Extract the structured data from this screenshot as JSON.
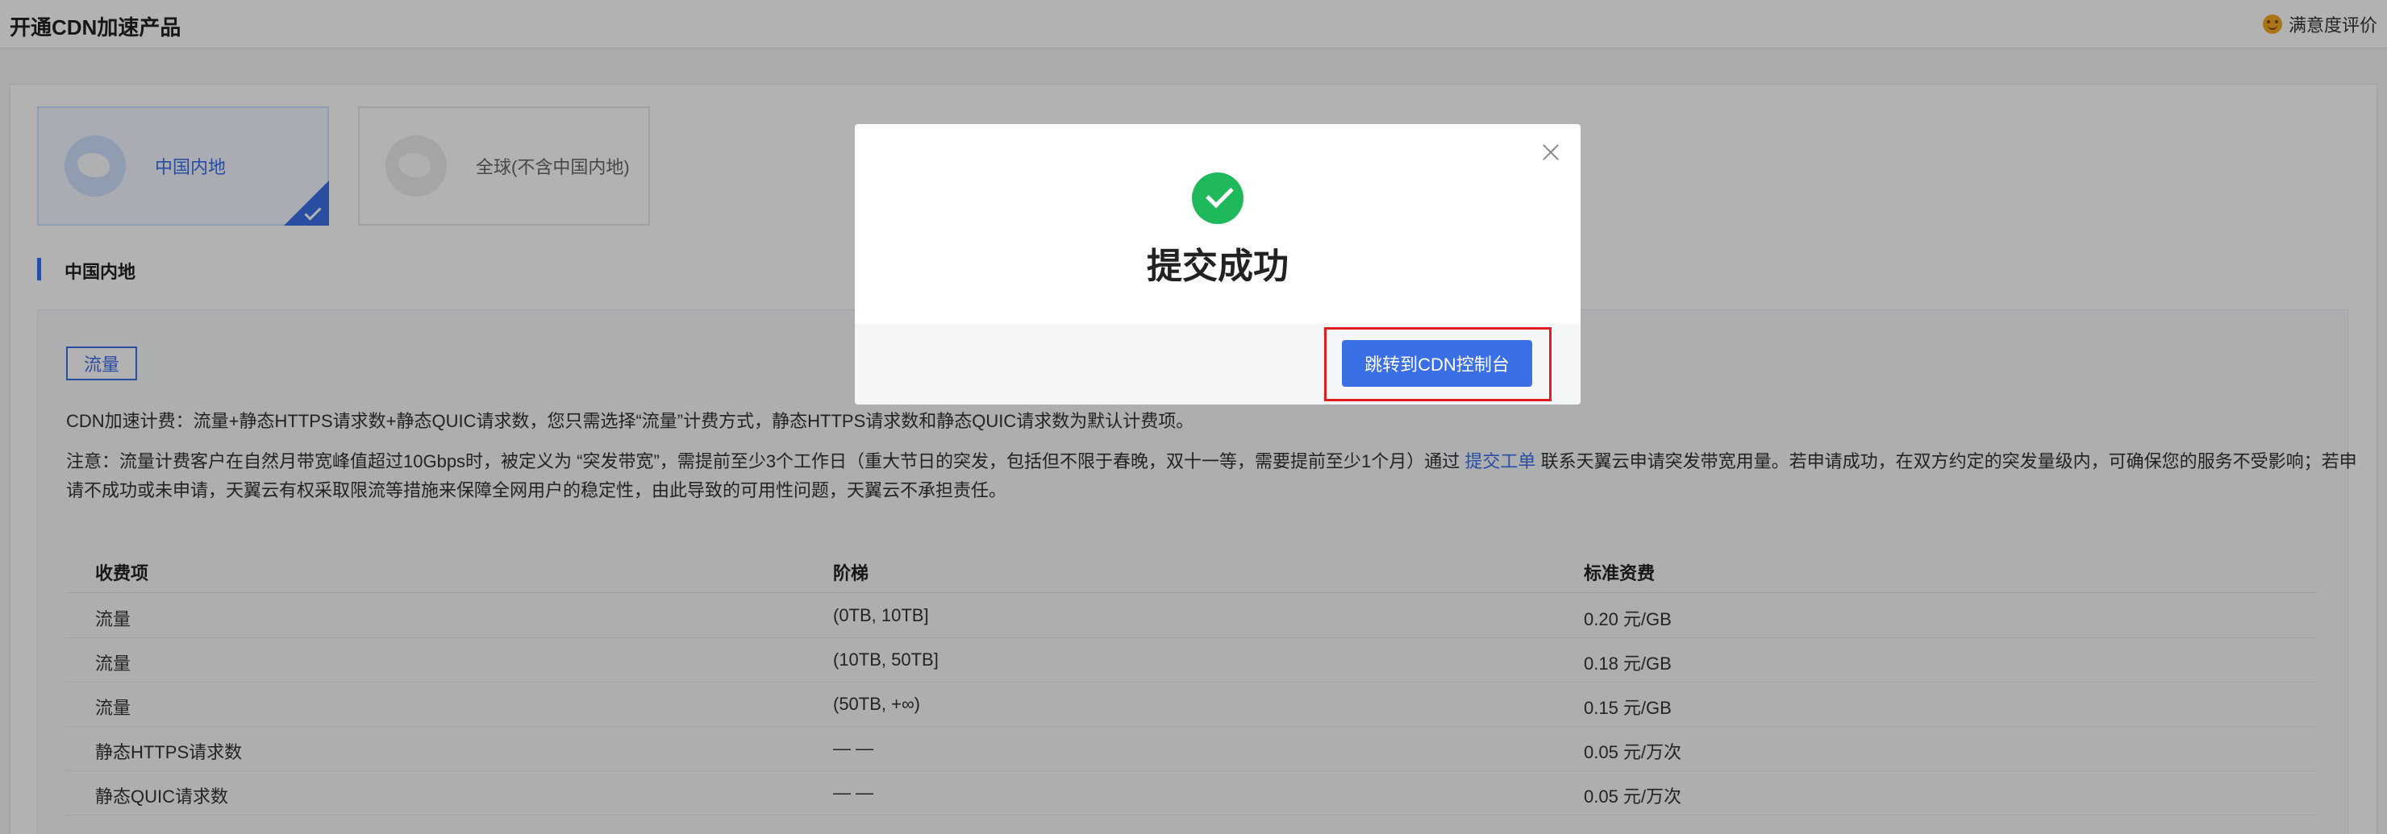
{
  "header": {
    "title": "开通CDN加速产品",
    "satisfaction_label": "满意度评价"
  },
  "regions": [
    {
      "label": "中国内地",
      "selected": true
    },
    {
      "label": "全球(不含中国内地)",
      "selected": false
    }
  ],
  "section": {
    "title": "中国内地"
  },
  "billing": {
    "tag": "流量",
    "line1": "CDN加速计费：流量+静态HTTPS请求数+静态QUIC请求数，您只需选择“流量”计费方式，静态HTTPS请求数和静态QUIC请求数为默认计费项。",
    "note_before_link": "注意：流量计费客户在自然月带宽峰值超过10Gbps时，被定义为 “突发带宽”，需提前至少3个工作日（重大节日的突发，包括但不限于春晚，双十一等，需要提前至少1个月）通过",
    "note_link": "提交工单",
    "note_after_link": "联系天翼云申请突发带宽用量。若申请成功，在双方约定的突发量级内，可确保您的服务不受影响；若申",
    "note_line2": "请不成功或未申请，天翼云有权采取限流等措施来保障全网用户的稳定性，由此导致的可用性问题，天翼云不承担责任。"
  },
  "table": {
    "headers": [
      "收费项",
      "阶梯",
      "标准资费"
    ],
    "rows": [
      [
        "流量",
        "(0TB, 10TB]",
        "0.20 元/GB"
      ],
      [
        "流量",
        "(10TB, 50TB]",
        "0.18 元/GB"
      ],
      [
        "流量",
        "(50TB, +∞)",
        "0.15 元/GB"
      ],
      [
        "静态HTTPS请求数",
        "— —",
        "0.05 元/万次"
      ],
      [
        "静态QUIC请求数",
        "— —",
        "0.05 元/万次"
      ]
    ]
  },
  "modal": {
    "title": "提交成功",
    "button_label": "跳转到CDN控制台"
  },
  "colors": {
    "accent": "#3b6fe6",
    "success": "#1fb85a",
    "highlight": "#e02020"
  },
  "icons": {
    "success": "check-circle-icon",
    "close": "close-icon",
    "satisfaction": "smile-icon",
    "region_cn": "china-map-icon",
    "region_global": "world-map-icon"
  }
}
